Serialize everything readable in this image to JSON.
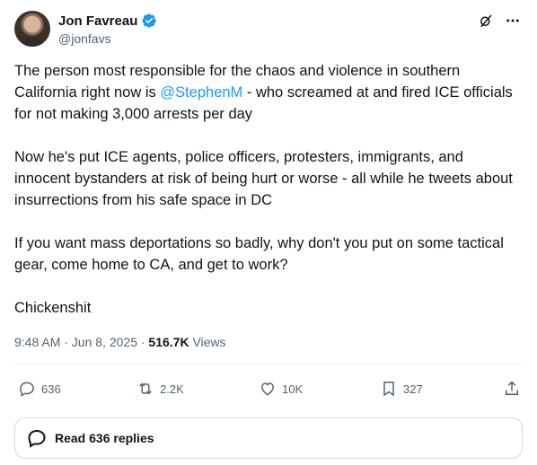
{
  "author": {
    "name": "Jon Favreau",
    "handle": "@jonfavs"
  },
  "tweet": {
    "paragraphs": [
      {
        "before": "The person most responsible for the chaos and violence in southern California right now is ",
        "mention": "@StephenM",
        "after": " - who screamed at and fired ICE officials for not making 3,000 arrests per day"
      },
      {
        "text": "Now he's put ICE agents, police officers, protesters, immigrants, and innocent bystanders at risk of being hurt or worse - all while he tweets about insurrections from his safe space in DC"
      },
      {
        "text": "If you want mass deportations so badly, why don't you put on some tactical gear, come home to CA, and get to work?"
      },
      {
        "text": "Chickenshit"
      }
    ],
    "timestamp": "9:48 AM · Jun 8, 2025 · ",
    "views_count": "516.7K",
    "views_label": " Views"
  },
  "actions": {
    "replies": "636",
    "reposts": "2.2K",
    "likes": "10K",
    "bookmarks": "327"
  },
  "read_replies_label": "Read 636 replies",
  "icons": [
    "verified-badge-icon",
    "grok-icon",
    "more-icon",
    "reply-icon",
    "repost-icon",
    "like-icon",
    "bookmark-icon",
    "share-icon"
  ],
  "colors": {
    "accent": "#1d9bf0",
    "text": "#0f1419",
    "muted": "#536471",
    "border": "#cfd9de"
  }
}
